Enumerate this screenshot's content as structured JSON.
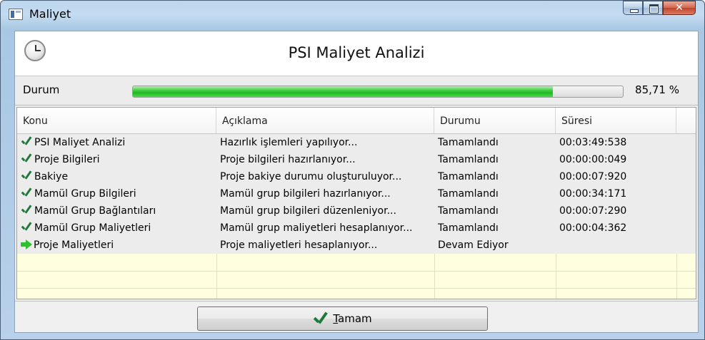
{
  "window": {
    "title": "Maliyet",
    "icon": "app-window-icon"
  },
  "header": {
    "title": "PSI Maliyet Analizi",
    "icon": "clock-icon"
  },
  "status": {
    "label": "Durum",
    "progress_value": 0.8571,
    "progress_text": "85,71 %"
  },
  "grid": {
    "columns": [
      "Konu",
      "Açıklama",
      "Durumu",
      "Süresi"
    ],
    "rows": [
      {
        "icon": "check-icon",
        "konu": "PSI Maliyet Analizi",
        "aciklama": "Hazırlık işlemleri yapılıyor...",
        "durumu": "Tamamlandı",
        "suresi": "00:03:49:538"
      },
      {
        "icon": "check-icon",
        "konu": "Proje Bilgileri",
        "aciklama": "Proje bilgileri hazırlanıyor...",
        "durumu": "Tamamlandı",
        "suresi": "00:00:00:049"
      },
      {
        "icon": "check-icon",
        "konu": "Bakiye",
        "aciklama": "Proje bakiye durumu oluşturuluyor...",
        "durumu": "Tamamlandı",
        "suresi": "00:00:07:920"
      },
      {
        "icon": "check-icon",
        "konu": "Mamül Grup Bilgileri",
        "aciklama": "Mamül grup bilgileri hazırlanıyor...",
        "durumu": "Tamamlandı",
        "suresi": "00:00:34:171"
      },
      {
        "icon": "check-icon",
        "konu": "Mamül Grup Bağlantıları",
        "aciklama": "Mamül grup bilgileri düzenleniyor...",
        "durumu": "Tamamlandı",
        "suresi": "00:00:07:290"
      },
      {
        "icon": "check-icon",
        "konu": "Mamül Grup Maliyetleri",
        "aciklama": "Mamül grup maliyetleri hesaplanıyor...",
        "durumu": "Tamamlandı",
        "suresi": "00:00:04:362"
      },
      {
        "icon": "arrow-right-icon",
        "konu": "Proje Maliyetleri",
        "aciklama": "Proje maliyetleri hesaplanıyor...",
        "durumu": "Devam Ediyor",
        "suresi": ""
      }
    ]
  },
  "footer": {
    "ok_label_mnemonic": "T",
    "ok_label_rest": "amam"
  },
  "colors": {
    "progress_green": "#20b820",
    "check_green": "#1d7a3a",
    "grid_empty_bg": "#ffffe0"
  }
}
